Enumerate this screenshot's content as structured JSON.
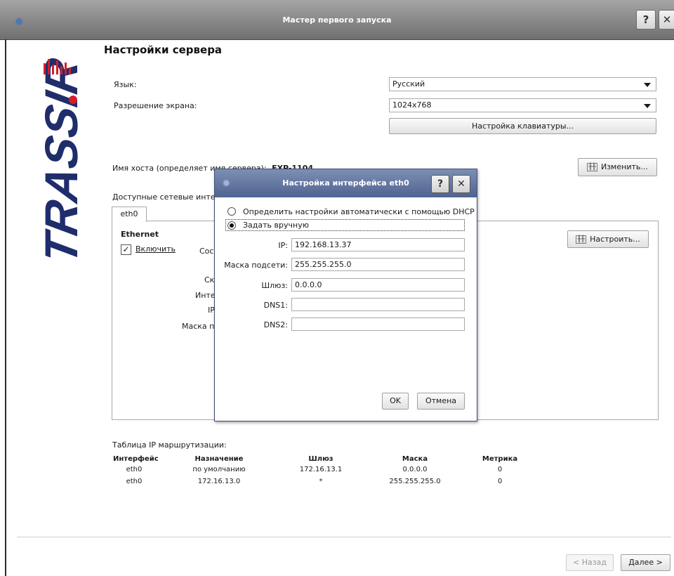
{
  "window": {
    "title": "Мастер первого запуска",
    "help_glyph": "?",
    "close_glyph": "✕",
    "icon": "gear-icon"
  },
  "brand": {
    "logo_text": "TRASSIR"
  },
  "page": {
    "title": "Настройки сервера"
  },
  "server": {
    "language_label": "Язык:",
    "language_value": "Русский",
    "resolution_label": "Разрешение экрана:",
    "resolution_value": "1024x768",
    "keyboard_button": "Настройка клавиатуры...",
    "hostname_label": "Имя хоста (определяет имя сервера):",
    "hostname_value": "EXP-1104",
    "change_button": "Изменить...",
    "interfaces_label": "Доступные сетевые интерфейсы:"
  },
  "tabs": [
    {
      "label": "eth0"
    }
  ],
  "eth_panel": {
    "heading": "Ethernet",
    "enable_label": "Включить",
    "enable_checked": true,
    "configure_button": "Настроить...",
    "partial_labels": [
      "Сост",
      "Ск",
      "Инте",
      "IP",
      "Маска по"
    ]
  },
  "routing": {
    "title": "Таблица IP маршрутизации:",
    "headers": [
      "Интерфейс",
      "Назначение",
      "Шлюз",
      "Маска",
      "Метрика"
    ],
    "rows": [
      [
        "eth0",
        "по умолчанию",
        "172.16.13.1",
        "0.0.0.0",
        "0"
      ],
      [
        "eth0",
        "172.16.13.0",
        "*",
        "255.255.255.0",
        "0"
      ]
    ]
  },
  "nav": {
    "back": "< Назад",
    "next": "Далее >"
  },
  "dialog": {
    "title": "Настройка интерфейса eth0",
    "help_glyph": "?",
    "close_glyph": "✕",
    "radio_dhcp": "Определить настройки автоматически с помощью DHCP",
    "radio_manual": "Задать вручную",
    "selected": "manual",
    "fields": {
      "ip_label": "IP:",
      "ip_value": "192.168.13.37",
      "mask_label": "Маска подсети:",
      "mask_value": "255.255.255.0",
      "gateway_label": "Шлюз:",
      "gateway_value": "0.0.0.0",
      "dns1_label": "DNS1:",
      "dns1_value": "",
      "dns2_label": "DNS2:",
      "dns2_value": ""
    },
    "ok": "OK",
    "cancel": "Отмена"
  },
  "colors": {
    "brand_red": "#d21f2a",
    "brand_navy": "#1f2d6b",
    "dialog_title": "#5a6e9a"
  }
}
